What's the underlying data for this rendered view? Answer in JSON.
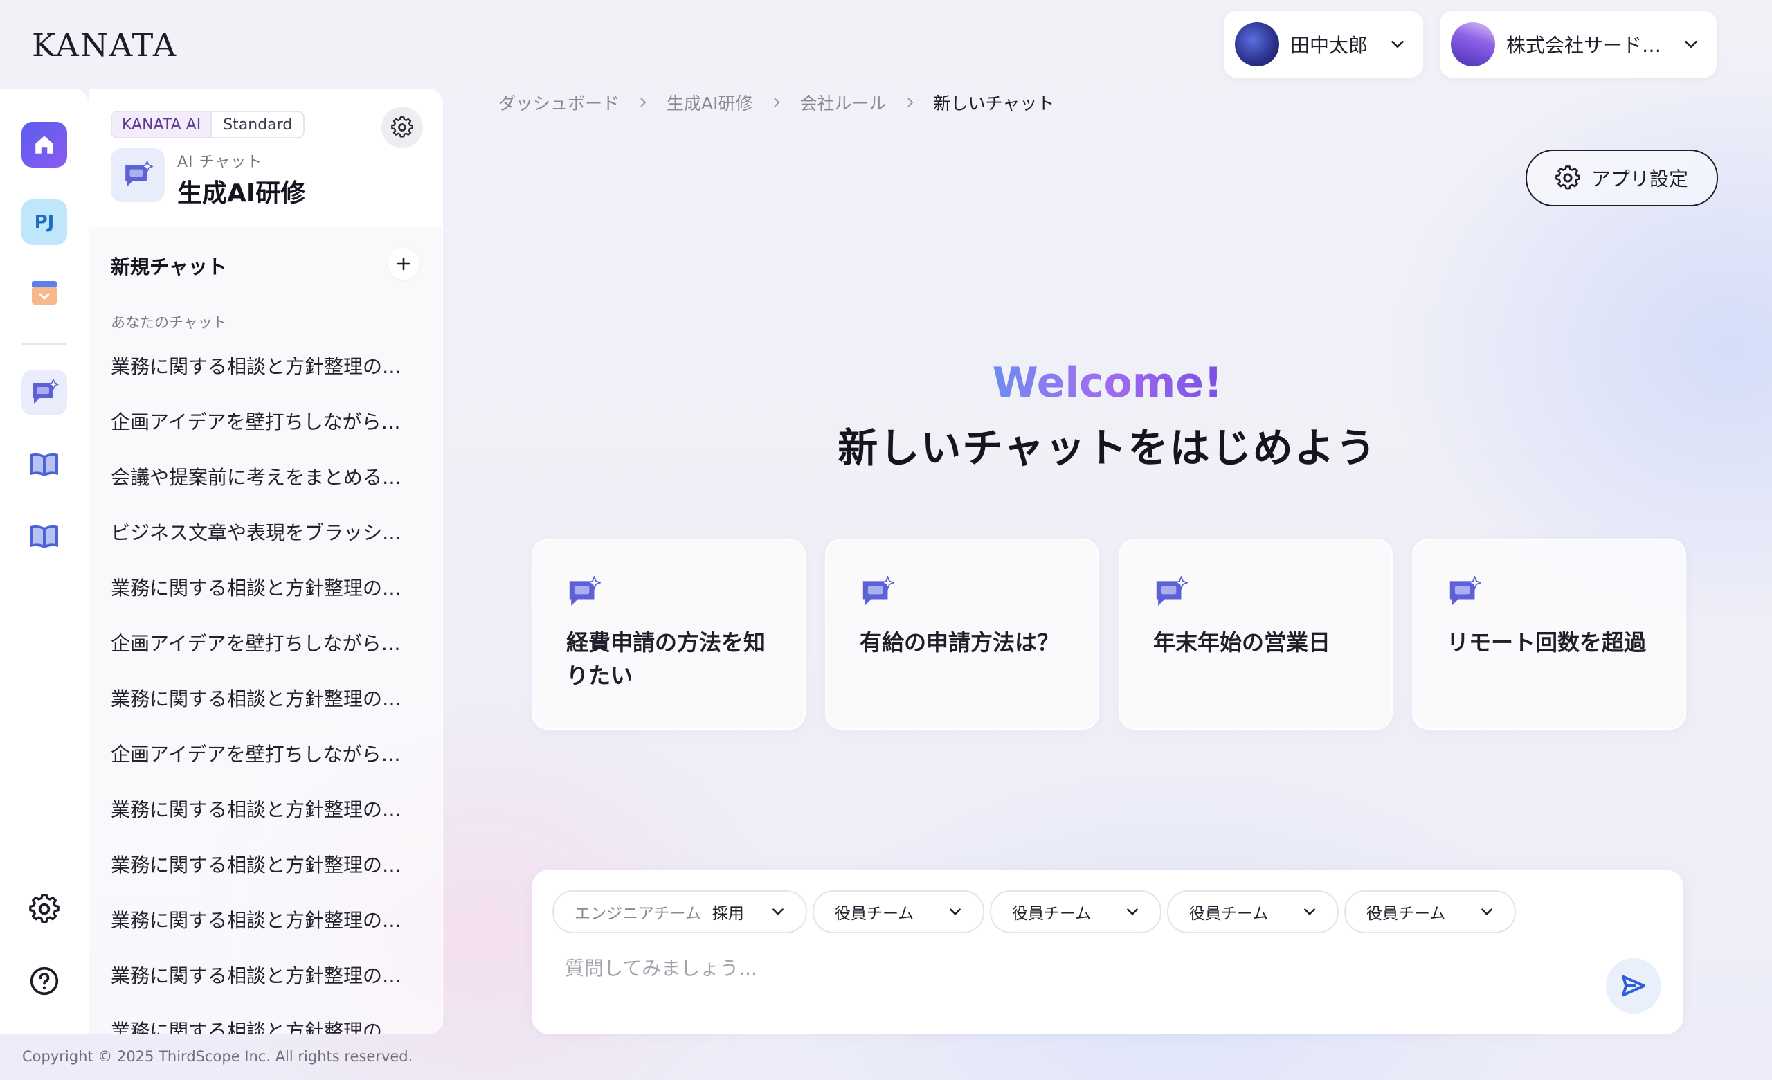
{
  "brand": {
    "logo_text": "KANATA"
  },
  "header": {
    "user": {
      "name": "田中太郎"
    },
    "org": {
      "name": "株式会社サード…"
    }
  },
  "colors": {
    "accent": "#7b4fe6",
    "home_gradient_start": "#5b5cf0",
    "home_gradient_end": "#8a5bf0"
  },
  "panel": {
    "plan_brand": "KANATA AI",
    "plan_tier": "Standard",
    "app_subtitle": "AI チャット",
    "app_title": "生成AI研修",
    "new_chat_label": "新規チャット",
    "your_chats_label": "あなたのチャット",
    "history": [
      "業務に関する相談と方針整理の…",
      "企画アイデアを壁打ちしながら…",
      "会議や提案前に考えをまとめる…",
      "ビジネス文章や表現をブラッシ…",
      "業務に関する相談と方針整理の…",
      "企画アイデアを壁打ちしながら…",
      "業務に関する相談と方針整理の…",
      "企画アイデアを壁打ちしながら…",
      "業務に関する相談と方針整理の…",
      "業務に関する相談と方針整理の…",
      "業務に関する相談と方針整理の…",
      "業務に関する相談と方針整理の…",
      "業務に関する相談と方針整理の…"
    ]
  },
  "rail": {
    "project_label": "PJ"
  },
  "breadcrumb": [
    "ダッシュボード",
    "生成AI研修",
    "会社ルール",
    "新しいチャット"
  ],
  "app_settings_label": "アプリ設定",
  "main": {
    "welcome": "Welcome!",
    "headline": "新しいチャットをはじめよう",
    "suggestions": [
      "経費申請の方法を知りたい",
      "有給の申請方法は？",
      "年末年始の営業日",
      "リモート回数を超過"
    ]
  },
  "composer": {
    "filters": [
      {
        "muted": "エンジニアチーム",
        "value": "採用"
      },
      {
        "value": "役員チーム"
      },
      {
        "value": "役員チーム"
      },
      {
        "value": "役員チーム"
      },
      {
        "value": "役員チーム"
      }
    ],
    "placeholder": "質問してみましょう..."
  },
  "footer": {
    "copyright": "Copyright © 2025 ThirdScope Inc. All rights reserved."
  }
}
